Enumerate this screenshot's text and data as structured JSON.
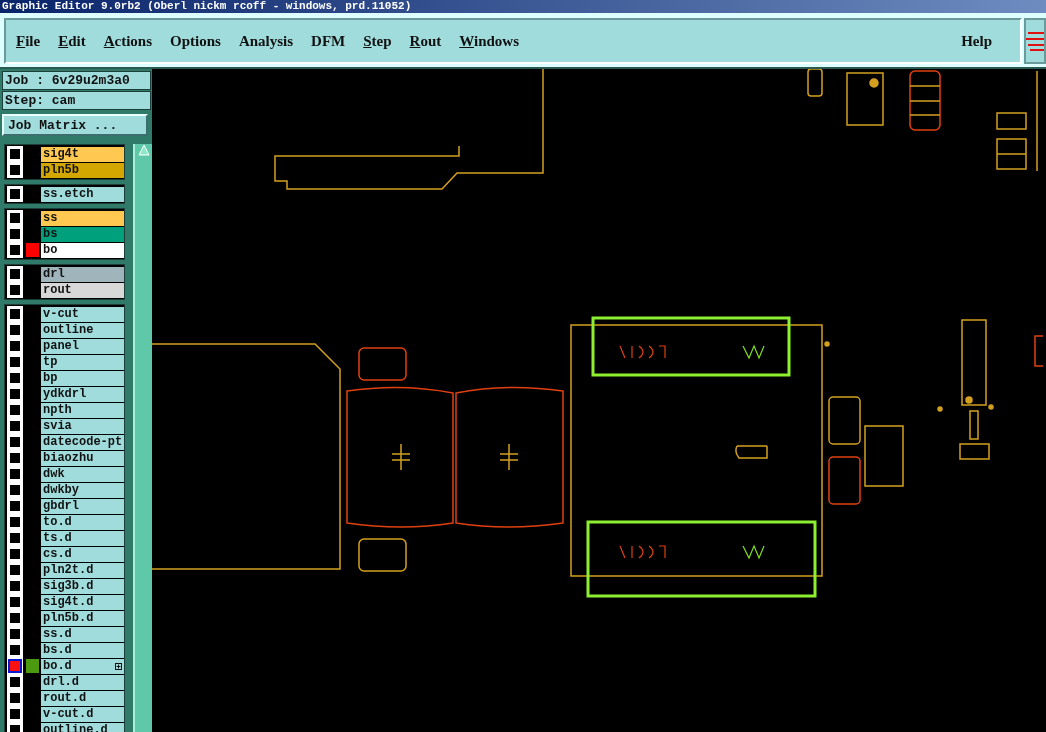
{
  "window": {
    "title": "Graphic Editor 9.0rb2 (Oberl nickm rcoff - windows, prd.11052)"
  },
  "menu": [
    {
      "label": "File",
      "mnemonic": true
    },
    {
      "label": "Edit",
      "mnemonic": true
    },
    {
      "label": "Actions",
      "mnemonic": true
    },
    {
      "label": "Options",
      "mnemonic": false
    },
    {
      "label": "Analysis",
      "mnemonic": false
    },
    {
      "label": "DFM",
      "mnemonic": false
    },
    {
      "label": "Step",
      "mnemonic": true
    },
    {
      "label": "Rout",
      "mnemonic": true
    },
    {
      "label": "Windows",
      "mnemonic": true
    }
  ],
  "help": "Help",
  "job": "Job : 6v29u2m3a0",
  "step": "Step: cam",
  "job_matrix_button": "Job Matrix ...",
  "layer_groups": [
    {
      "layers": [
        {
          "name": "sig4t",
          "color": "#ffc850",
          "checked": false
        },
        {
          "name": "pln5b",
          "color": "#d4a600",
          "checked": false
        }
      ]
    },
    {
      "layers": [
        {
          "name": "ss.etch",
          "color": "#a0dcdc",
          "checked": false
        }
      ]
    },
    {
      "layers": [
        {
          "name": "ss",
          "color": "#ffc850",
          "checked": false
        },
        {
          "name": "bs",
          "color": "#00a07c",
          "checked": false
        },
        {
          "name": "bo",
          "color": "#ffffff",
          "checked": false,
          "swatch": {
            "color": "#ff0000"
          }
        }
      ]
    },
    {
      "layers": [
        {
          "name": "drl",
          "color": "#a0b4bc",
          "checked": false
        },
        {
          "name": "rout",
          "color": "#d8d8d8",
          "checked": false
        }
      ]
    },
    {
      "layers": [
        {
          "name": "v-cut",
          "color": "#a0dcdc",
          "checked": false
        },
        {
          "name": "outline",
          "color": "#a0dcdc",
          "checked": false
        },
        {
          "name": "panel",
          "color": "#a0dcdc",
          "checked": false
        },
        {
          "name": "tp",
          "color": "#a0dcdc",
          "checked": false
        },
        {
          "name": "bp",
          "color": "#a0dcdc",
          "checked": false
        },
        {
          "name": "ydkdrl",
          "color": "#a0dcdc",
          "checked": false
        },
        {
          "name": "npth",
          "color": "#a0dcdc",
          "checked": false
        },
        {
          "name": "svia",
          "color": "#a0dcdc",
          "checked": false
        },
        {
          "name": "datecode-pt",
          "color": "#a0dcdc",
          "checked": false
        },
        {
          "name": "biaozhu",
          "color": "#a0dcdc",
          "checked": false
        },
        {
          "name": "dwk",
          "color": "#a0dcdc",
          "checked": false
        },
        {
          "name": "dwkby",
          "color": "#a0dcdc",
          "checked": false
        },
        {
          "name": "gbdrl",
          "color": "#a0dcdc",
          "checked": false
        },
        {
          "name": "to.d",
          "color": "#a0dcdc",
          "checked": false
        },
        {
          "name": "ts.d",
          "color": "#a0dcdc",
          "checked": false
        },
        {
          "name": "cs.d",
          "color": "#a0dcdc",
          "checked": false
        },
        {
          "name": "pln2t.d",
          "color": "#a0dcdc",
          "checked": false
        },
        {
          "name": "sig3b.d",
          "color": "#a0dcdc",
          "checked": false
        },
        {
          "name": "sig4t.d",
          "color": "#a0dcdc",
          "checked": false
        },
        {
          "name": "pln5b.d",
          "color": "#a0dcdc",
          "checked": false
        },
        {
          "name": "ss.d",
          "color": "#a0dcdc",
          "checked": false
        },
        {
          "name": "bs.d",
          "color": "#a0dcdc",
          "checked": false
        },
        {
          "name": "bo.d",
          "color": "#a0dcdc",
          "checked": true,
          "swatch": {
            "color": "#4c9a10"
          },
          "expandable": true
        },
        {
          "name": "drl.d",
          "color": "#a0dcdc",
          "checked": false
        },
        {
          "name": "rout.d",
          "color": "#a0dcdc",
          "checked": false
        },
        {
          "name": "v-cut.d",
          "color": "#a0dcdc",
          "checked": false
        },
        {
          "name": "outline.d",
          "color": "#a0dcdc",
          "checked": false
        }
      ]
    }
  ]
}
